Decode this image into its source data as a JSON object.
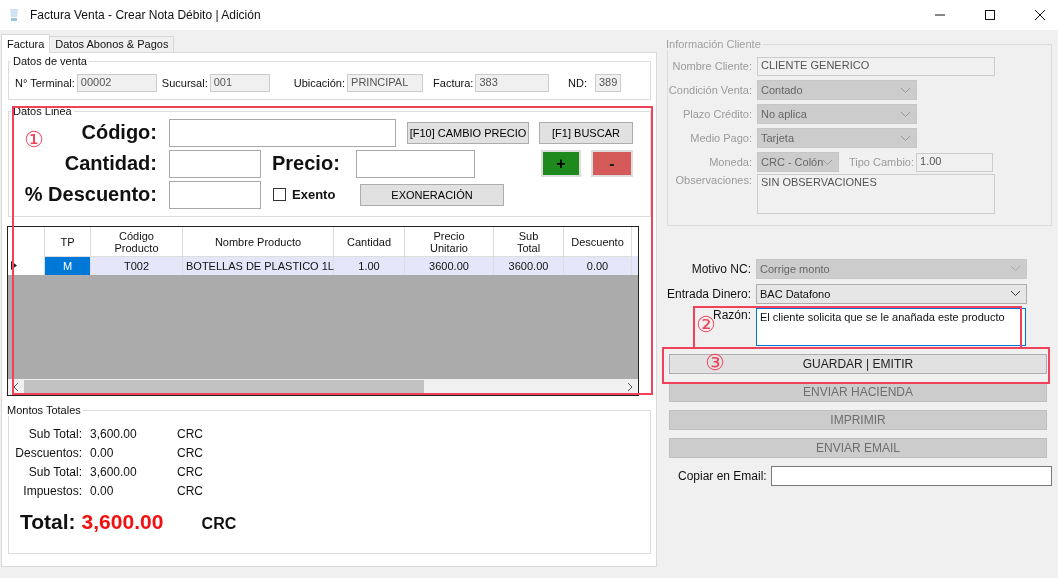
{
  "window": {
    "title": "Factura Venta - Crear Nota Débito | Adición"
  },
  "tabs": [
    {
      "label": "Factura",
      "selected": true
    },
    {
      "label": "Datos Abonos & Pagos",
      "selected": false
    }
  ],
  "sale_data": {
    "title": "Datos de venta",
    "fields": [
      {
        "label": "N° Terminal:",
        "value": "00002"
      },
      {
        "label": "Sucursal:",
        "value": "001"
      },
      {
        "label": "Ubicación:",
        "value": "PRINCIPAL"
      },
      {
        "label": "Factura:",
        "value": "383"
      },
      {
        "label": "ND:",
        "value": "389"
      }
    ]
  },
  "line_data": {
    "title": "Datos Linea",
    "labels": [
      "Código:",
      "Cantidad:",
      "Precio:",
      "% Descuento:"
    ],
    "exento": {
      "label": "Exento",
      "checked": false
    },
    "buttons": [
      {
        "label": "[F10] CAMBIO PRECIO",
        "kind": "plain"
      },
      {
        "label": "[F1] BUSCAR",
        "kind": "plain"
      },
      {
        "label": "+",
        "kind": "add"
      },
      {
        "label": "-",
        "kind": "remove"
      },
      {
        "label": "EXONERACIÓN",
        "kind": "plain"
      }
    ]
  },
  "table": {
    "columns": [
      "TP",
      "Código\nProducto",
      "Nombre Producto",
      "Cantidad",
      "Precio\nUnitario",
      "Sub\nTotal",
      "Descuento"
    ],
    "rows": [
      {
        "selected": true,
        "cells": [
          "M",
          "T002",
          "BOTELLAS DE PLASTICO 1L",
          "1.00",
          "3600.00",
          "3600.00",
          "0.00"
        ]
      }
    ]
  },
  "totals": {
    "title": "Montos Totales",
    "rows": [
      {
        "label": "Sub Total:",
        "value": "3,600.00",
        "currency": "CRC"
      },
      {
        "label": "Descuentos:",
        "value": "0.00",
        "currency": "CRC"
      },
      {
        "label": "Sub Total:",
        "value": "3,600.00",
        "currency": "CRC"
      },
      {
        "label": "Impuestos:",
        "value": "0.00",
        "currency": "CRC"
      }
    ],
    "total": {
      "label": "Total:",
      "value": "3,600.00",
      "currency": "CRC"
    }
  },
  "client_info": {
    "title": "Información Cliente",
    "disabled": true,
    "fields": [
      {
        "label": "Nombre Cliente:",
        "value": "CLIENTE GENERICO",
        "kind": "text"
      },
      {
        "label": "Condición Venta:",
        "value": "Contado",
        "kind": "select"
      },
      {
        "label": "Plazo Crédito:",
        "value": "No aplica",
        "kind": "select"
      },
      {
        "label": "Medio Pago:",
        "value": "Tarjeta",
        "kind": "select"
      },
      {
        "label": "Moneda:",
        "value": "CRC - Colón",
        "kind": "select"
      },
      {
        "label": "Tipo Cambio:",
        "value": "1.00",
        "kind": "text"
      },
      {
        "label": "Observaciones:",
        "value": "SIN OBSERVACIONES",
        "kind": "textarea"
      }
    ]
  },
  "note": {
    "fields": [
      {
        "label": "Motivo NC:",
        "value": "Corrige monto",
        "kind": "select",
        "disabled": true
      },
      {
        "label": "Entrada Dinero:",
        "value": "BAC Datafono",
        "kind": "select",
        "disabled": false
      },
      {
        "label": "Razón:",
        "value": "El cliente solicita que se le anañada este producto",
        "kind": "textarea",
        "disabled": false
      }
    ],
    "buttons": [
      {
        "label": "GUARDAR | EMITIR",
        "disabled": false
      },
      {
        "label": "ENVIAR HACIENDA",
        "disabled": true
      },
      {
        "label": "IMPRIMIR",
        "disabled": true
      },
      {
        "label": "ENVIAR EMAIL",
        "disabled": true
      }
    ],
    "email": {
      "label": "Copiar en Email:"
    }
  },
  "annotations": [
    {
      "label": "①"
    },
    {
      "label": "②"
    },
    {
      "label": "③"
    }
  ]
}
